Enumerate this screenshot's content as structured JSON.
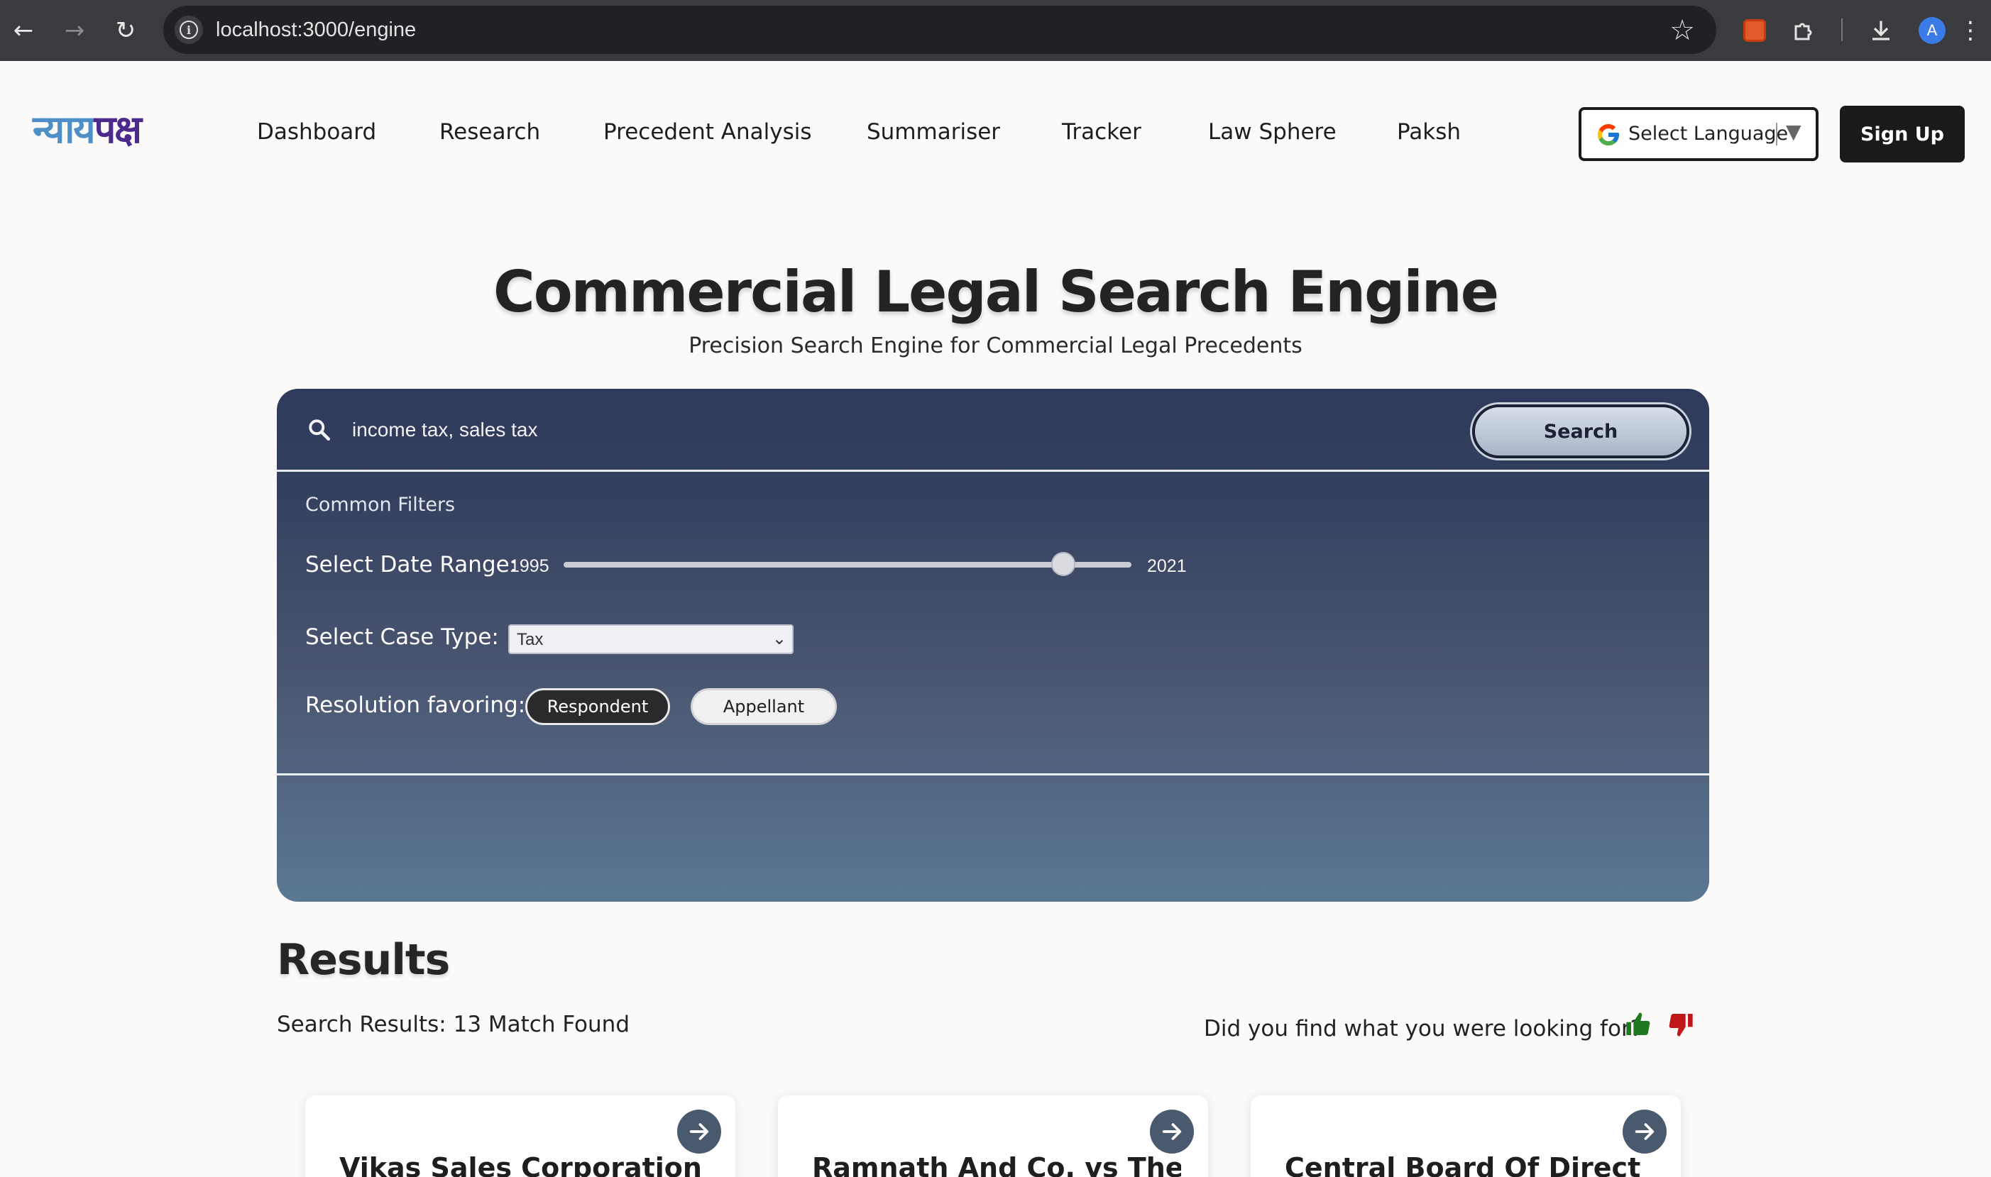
{
  "browser": {
    "url": "localhost:3000/engine",
    "profile_initial": "A",
    "icons": [
      "back-arrow-icon",
      "forward-arrow-icon",
      "reload-icon",
      "site-info-icon",
      "bookmark-star-icon",
      "extension-icon",
      "puzzle-extensions-icon",
      "download-icon",
      "profile-avatar",
      "kebab-menu-icon"
    ]
  },
  "header": {
    "logo_part1": "न्याय",
    "logo_part2": "पक्ष",
    "nav": [
      "Dashboard",
      "Research",
      "Precedent Analysis",
      "Summariser",
      "Tracker",
      "Law Sphere",
      "Paksh"
    ],
    "language_label": "Select Language",
    "signup_label": "Sign Up"
  },
  "hero": {
    "title": "Commercial Legal Search Engine",
    "subtitle": "Precision Search Engine for Commercial Legal Precedents"
  },
  "search": {
    "query": "income tax, sales tax",
    "button_label": "Search",
    "filters_title": "Common Filters",
    "date_range_label": "Select Date Range:",
    "range_min": "1995",
    "range_max": "2021",
    "range_selected_end_fraction": 0.88,
    "case_type_label": "Select Case Type:",
    "case_type_value": "Tax",
    "resolution_label": "Resolution favoring:",
    "resolution_options": [
      "Respondent",
      "Appellant"
    ],
    "resolution_selected": "Respondent"
  },
  "results": {
    "title": "Results",
    "count_text": "Search Results: 13 Match Found",
    "feedback_question": "Did you find what you were looking for?",
    "cards": [
      {
        "title": "Vikas Sales Corporation And"
      },
      {
        "title": "Ramnath And Co. vs The"
      },
      {
        "title": "Central Board Of Direct"
      }
    ]
  },
  "colors": {
    "panel_top": "#2f3a5c",
    "panel_bottom": "#5a7893",
    "thumb_up": "#1f7a1f",
    "thumb_down": "#c01818",
    "logo_blue": "#4e8fc8",
    "logo_purple": "#4b2a8c"
  }
}
